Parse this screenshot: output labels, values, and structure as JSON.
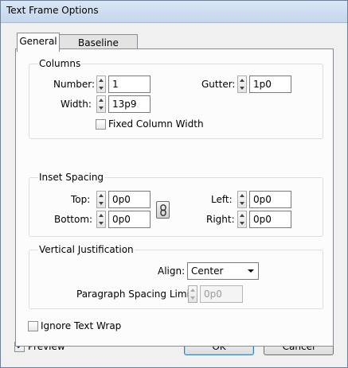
{
  "window": {
    "title": "Text Frame Options"
  },
  "tabs": [
    {
      "label": "General",
      "active": true
    },
    {
      "label": "Baseline Options",
      "active": false
    }
  ],
  "columns": {
    "group_label": "Columns",
    "number_label": "Number:",
    "number_value": "1",
    "gutter_label": "Gutter:",
    "gutter_value": "1p0",
    "width_label": "Width:",
    "width_value": "13p9",
    "fixed_width_label": "Fixed Column Width",
    "fixed_width_checked": false
  },
  "inset_spacing": {
    "group_label": "Inset Spacing",
    "top_label": "Top:",
    "top_value": "0p0",
    "bottom_label": "Bottom:",
    "bottom_value": "0p0",
    "left_label": "Left:",
    "left_value": "0p0",
    "right_label": "Right:",
    "right_value": "0p0",
    "link_icon": "chain-link-icon"
  },
  "vertical_justification": {
    "group_label": "Vertical Justification",
    "align_label": "Align:",
    "align_value": "Center",
    "paragraph_spacing_label": "Paragraph Spacing Limit:",
    "paragraph_spacing_value": "0p0",
    "paragraph_spacing_enabled": false
  },
  "ignore_text_wrap": {
    "label": "Ignore Text Wrap",
    "checked": false
  },
  "footer": {
    "preview_label": "Preview",
    "preview_checked": true,
    "ok_label": "OK",
    "cancel_label": "Cancel"
  },
  "colors": {
    "title_bar": "#c4d7ee",
    "dialog_bg": "#f0f0f0",
    "panel_bg": "#fcfcfc",
    "default_button_border": "#3c7fb1",
    "checkmark": "#1b3f8b"
  }
}
